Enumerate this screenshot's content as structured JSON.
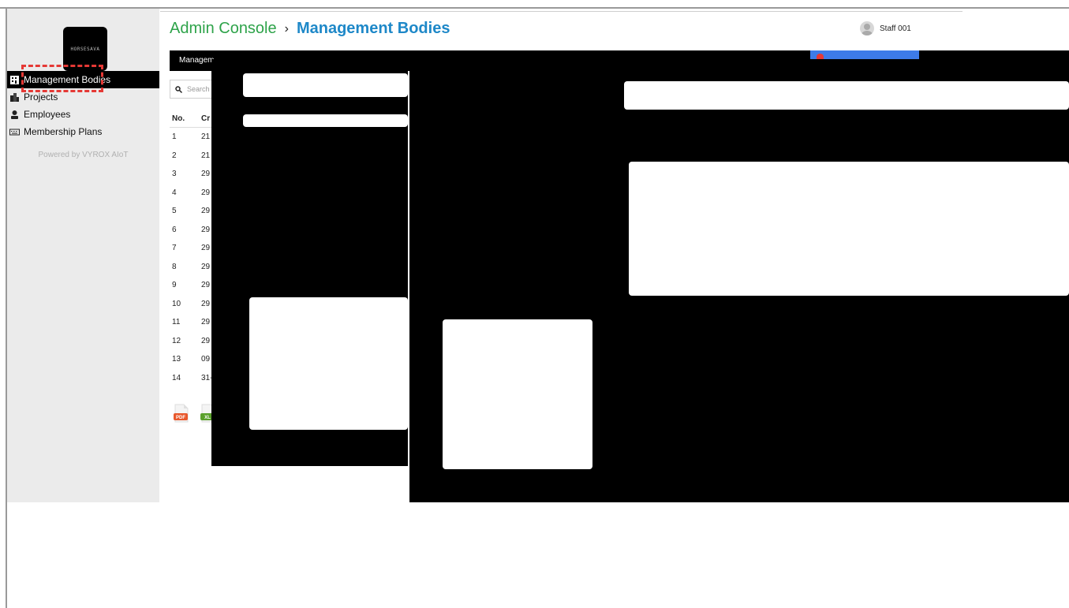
{
  "sidebar": {
    "logo_text": "HORSESAVA",
    "items": [
      {
        "label": "Management Bodies",
        "icon": "building-icon",
        "active": true
      },
      {
        "label": "Projects",
        "icon": "city-icon",
        "active": false
      },
      {
        "label": "Employees",
        "icon": "person-icon",
        "active": false
      },
      {
        "label": "Membership Plans",
        "icon": "keyboard-icon",
        "active": false
      }
    ],
    "powered_by": "Powered by VYROX AIoT"
  },
  "header": {
    "breadcrumb_root": "Admin Console",
    "breadcrumb_separator": "›",
    "breadcrumb_current": "Management Bodies",
    "user_name": "Staff 001"
  },
  "content": {
    "tab_label": "Managem",
    "search_placeholder": "Search",
    "table": {
      "headers": {
        "no": "No.",
        "created": "Cr"
      },
      "rows": [
        {
          "no": "1",
          "created": "21"
        },
        {
          "no": "2",
          "created": "21"
        },
        {
          "no": "3",
          "created": "29"
        },
        {
          "no": "4",
          "created": "29"
        },
        {
          "no": "5",
          "created": "29"
        },
        {
          "no": "6",
          "created": "29"
        },
        {
          "no": "7",
          "created": "29"
        },
        {
          "no": "8",
          "created": "29"
        },
        {
          "no": "9",
          "created": "29"
        },
        {
          "no": "10",
          "created": "29"
        },
        {
          "no": "11",
          "created": "29"
        },
        {
          "no": "12",
          "created": "29"
        },
        {
          "no": "13",
          "created": "09"
        },
        {
          "no": "14",
          "created": "31-"
        }
      ]
    },
    "export_pdf_label": "PDF",
    "export_xls_label": "XL"
  },
  "colors": {
    "breadcrumb_root": "#2ea34a",
    "breadcrumb_current": "#1e88c8",
    "highlight": "#e53935",
    "new_button": "#3d7be8"
  }
}
